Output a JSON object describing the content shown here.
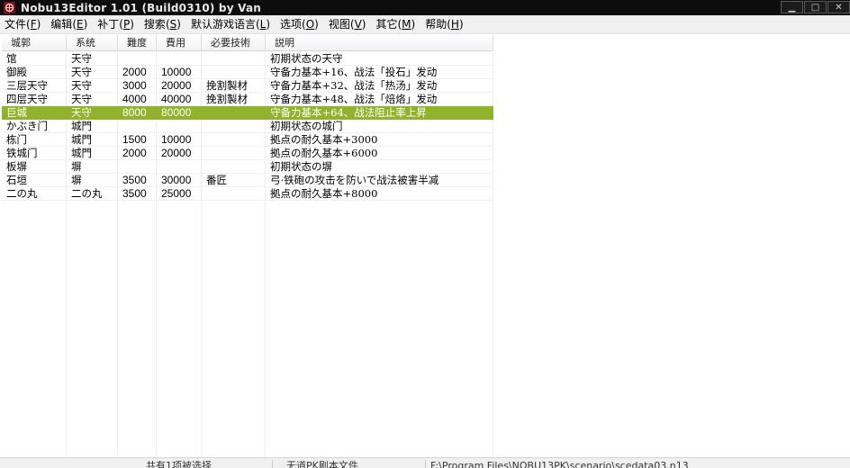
{
  "window": {
    "title": "Nobu13Editor 1.01 (Build0310) by Van",
    "icon": "app-mon-icon"
  },
  "menu": [
    {
      "label": "文件",
      "key": "F"
    },
    {
      "label": "编辑",
      "key": "E"
    },
    {
      "label": "补丁",
      "key": "P"
    },
    {
      "label": "搜索",
      "key": "S"
    },
    {
      "label": "默认游戏语言",
      "key": "L"
    },
    {
      "label": "选项",
      "key": "O"
    },
    {
      "label": "视图",
      "key": "V"
    },
    {
      "label": "其它",
      "key": "M"
    },
    {
      "label": "帮助",
      "key": "H"
    }
  ],
  "table": {
    "columns": [
      "城郭",
      "系统",
      "難度",
      "費用",
      "必要技術",
      "説明"
    ],
    "rows": [
      [
        "馆",
        "天守",
        "",
        "",
        "",
        "初期状态の天守"
      ],
      [
        "御殿",
        "天守",
        "2000",
        "10000",
        "",
        "守备力基本+16、战法「投石」发动"
      ],
      [
        "三层天守",
        "天守",
        "3000",
        "20000",
        "挽割製材",
        "守备力基本+32、战法「热汤」发动"
      ],
      [
        "四层天守",
        "天守",
        "4000",
        "40000",
        "挽割製材",
        "守备力基本+48、战法「焙烙」发动"
      ],
      [
        "巨城",
        "天守",
        "8000",
        "80000",
        "",
        "守备力基本+64、战法阻止率上昇"
      ],
      [
        "かぶき门",
        "城門",
        "",
        "",
        "",
        "初期状态の城门"
      ],
      [
        "栋门",
        "城門",
        "1500",
        "10000",
        "",
        "拠点の耐久基本+3000"
      ],
      [
        "铁城门",
        "城門",
        "2000",
        "20000",
        "",
        "拠点の耐久基本+6000"
      ],
      [
        "板塀",
        "塀",
        "",
        "",
        "",
        "初期状态の塀"
      ],
      [
        "石垣",
        "塀",
        "3500",
        "30000",
        "番匠",
        "弓·铁砲の攻击を防いで战法被害半减"
      ],
      [
        "二の丸",
        "二の丸",
        "3500",
        "25000",
        "",
        "拠点の耐久基本+8000"
      ]
    ],
    "selected_row": 4
  },
  "statusbar": {
    "selection": "共有1项被选择",
    "file_type": "无道PK剧本文件",
    "path": "F:\\Program Files\\NOBU13PK\\scenario\\scedata03.n13"
  },
  "colors": {
    "selection": "#8fb32a",
    "titlebar": "#0d0d0d"
  }
}
